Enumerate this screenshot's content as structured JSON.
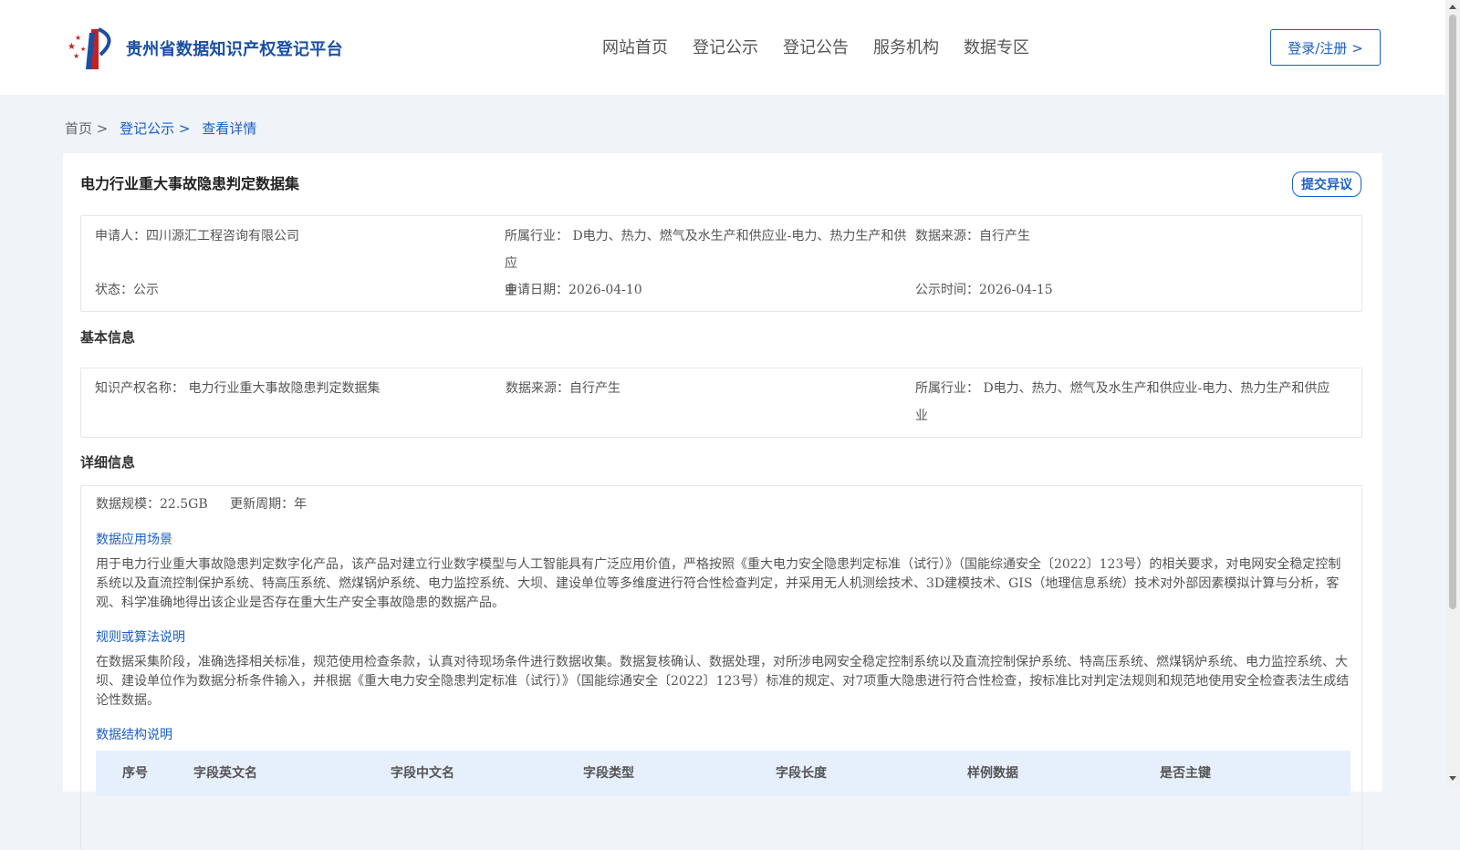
{
  "header": {
    "logo_text": "贵州省数据知识产权登记平台",
    "nav": [
      "网站首页",
      "登记公示",
      "登记公告",
      "服务机构",
      "数据专区"
    ],
    "login_label": "登录/注册 >"
  },
  "breadcrumb": {
    "home": "首页 >",
    "public": "登记公示 >",
    "current": "查看详情"
  },
  "detail": {
    "title": "电力行业重大事故隐患判定数据集",
    "objection_label": "提交异议",
    "summary": {
      "applicant": "申请人：四川源汇工程咨询有限公司",
      "industry_line1": "所属行业： D电力、热力、燃气及水生产和供应业-电力、热力生产和供应",
      "industry_line2": "业",
      "source": "数据来源：自行产生",
      "status": "状态：公示",
      "apply_date": "申请日期：2026-04-10",
      "public_date": "公示时间：2026-04-15"
    },
    "basic": {
      "section_title": "基本信息",
      "ip_name": "知识产权名称： 电力行业重大事故隐患判定数据集",
      "source": "数据来源：自行产生",
      "industry_line1": "所属行业： D电力、热力、燃气及水生产和供应业-电力、热力生产和供应",
      "industry_line2": "业"
    },
    "info": {
      "section_title": "详细信息",
      "scale": "数据规模：22.5GB",
      "cycle": "更新周期：年",
      "scenario_title": "数据应用场景",
      "scenario_text": "用于电力行业重大事故隐患判定数字化产品，该产品对建立行业数字模型与人工智能具有广泛应用价值，严格按照《重大电力安全隐患判定标准（试行）》（国能综通安全〔2022〕123号）的相关要求，对电网安全稳定控制系统以及直流控制保护系统、特高压系统、燃煤锅炉系统、电力监控系统、大坝、建设单位等多维度进行符合性检查判定，并采用无人机测绘技术、3D建模技术、GIS（地理信息系统）技术对外部因素模拟计算与分析，客观、科学准确地得出该企业是否存在重大生产安全事故隐患的数据产品。",
      "algorithm_title": "规则或算法说明",
      "algorithm_text": "在数据采集阶段，准确选择相关标准，规范使用检查条款，认真对待现场条件进行数据收集。数据复核确认、数据处理，对所涉电网安全稳定控制系统以及直流控制保护系统、特高压系统、燃煤锅炉系统、电力监控系统、大坝、建设单位作为数据分析条件输入，并根据《重大电力安全隐患判定标准（试行）》（国能综通安全〔2022〕123号）标准的规定、对7项重大隐患进行符合性检查，按标准比对判定法规则和规范地使用安全检查表法生成结论性数据。",
      "structure_title": "数据结构说明",
      "table_headers": [
        "序号",
        "字段英文名",
        "字段中文名",
        "字段类型",
        "字段长度",
        "样例数据",
        "是否主键"
      ]
    }
  }
}
